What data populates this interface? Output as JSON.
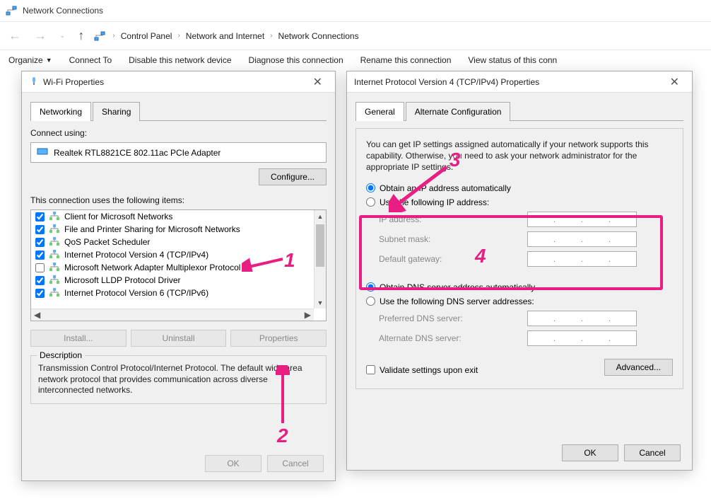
{
  "window": {
    "title": "Network Connections"
  },
  "breadcrumb": [
    "Control Panel",
    "Network and Internet",
    "Network Connections"
  ],
  "toolbar": {
    "organize": "Organize",
    "connect_to": "Connect To",
    "disable": "Disable this network device",
    "diagnose": "Diagnose this connection",
    "rename": "Rename this connection",
    "view_status": "View status of this conn"
  },
  "wifi_dialog": {
    "title": "Wi-Fi Properties",
    "tabs": {
      "networking": "Networking",
      "sharing": "Sharing"
    },
    "connect_using_label": "Connect using:",
    "adapter_name": "Realtek RTL8821CE 802.11ac PCIe Adapter",
    "configure_btn": "Configure...",
    "items_label": "This connection uses the following items:",
    "items": [
      {
        "checked": true,
        "label": "Client for Microsoft Networks"
      },
      {
        "checked": true,
        "label": "File and Printer Sharing for Microsoft Networks"
      },
      {
        "checked": true,
        "label": "QoS Packet Scheduler"
      },
      {
        "checked": true,
        "label": "Internet Protocol Version 4 (TCP/IPv4)"
      },
      {
        "checked": false,
        "label": "Microsoft Network Adapter Multiplexor Protocol"
      },
      {
        "checked": true,
        "label": "Microsoft LLDP Protocol Driver"
      },
      {
        "checked": true,
        "label": "Internet Protocol Version 6 (TCP/IPv6)"
      }
    ],
    "install_btn": "Install...",
    "uninstall_btn": "Uninstall",
    "properties_btn": "Properties",
    "description_label": "Description",
    "description_text": "Transmission Control Protocol/Internet Protocol. The default wide area network protocol that provides communication across diverse interconnected networks.",
    "ok_btn": "OK",
    "cancel_btn": "Cancel"
  },
  "tcpip_dialog": {
    "title": "Internet Protocol Version 4 (TCP/IPv4) Properties",
    "tabs": {
      "general": "General",
      "alternate": "Alternate Configuration"
    },
    "info": "You can get IP settings assigned automatically if your network supports this capability. Otherwise, you need to ask your network administrator for the appropriate IP settings.",
    "radio_auto_ip": "Obtain an IP address automatically",
    "radio_manual_ip": "Use the following IP address:",
    "ip_address_label": "IP address:",
    "subnet_label": "Subnet mask:",
    "gateway_label": "Default gateway:",
    "radio_auto_dns": "Obtain DNS server address automatically",
    "radio_manual_dns": "Use the following DNS server addresses:",
    "preferred_dns_label": "Preferred DNS server:",
    "alternate_dns_label": "Alternate DNS server:",
    "validate_label": "Validate settings upon exit",
    "advanced_btn": "Advanced...",
    "ok_btn": "OK",
    "cancel_btn": "Cancel"
  },
  "annotations": {
    "n1": "1",
    "n2": "2",
    "n3": "3",
    "n4": "4"
  }
}
